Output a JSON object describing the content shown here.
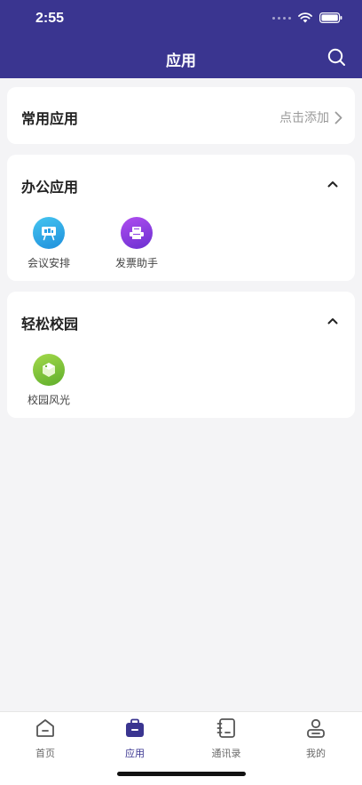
{
  "status_bar": {
    "time": "2:55"
  },
  "header": {
    "title": "应用"
  },
  "frequent": {
    "title": "常用应用",
    "add_label": "点击添加"
  },
  "office": {
    "title": "办公应用",
    "apps": [
      {
        "label": "会议安排",
        "icon": "meeting-icon",
        "color": "#2fa8e8"
      },
      {
        "label": "发票助手",
        "icon": "invoice-icon",
        "color": "#8a3fe0"
      }
    ]
  },
  "campus": {
    "title": "轻松校园",
    "apps": [
      {
        "label": "校园风光",
        "icon": "scenery-icon",
        "color": "#7cc23e"
      }
    ]
  },
  "tabbar": {
    "items": [
      {
        "label": "首页",
        "icon": "home-icon"
      },
      {
        "label": "应用",
        "icon": "briefcase-icon"
      },
      {
        "label": "通讯录",
        "icon": "contacts-icon"
      },
      {
        "label": "我的",
        "icon": "user-icon"
      }
    ],
    "active_index": 1
  },
  "colors": {
    "primary": "#3a3590",
    "background": "#f4f4f6"
  }
}
